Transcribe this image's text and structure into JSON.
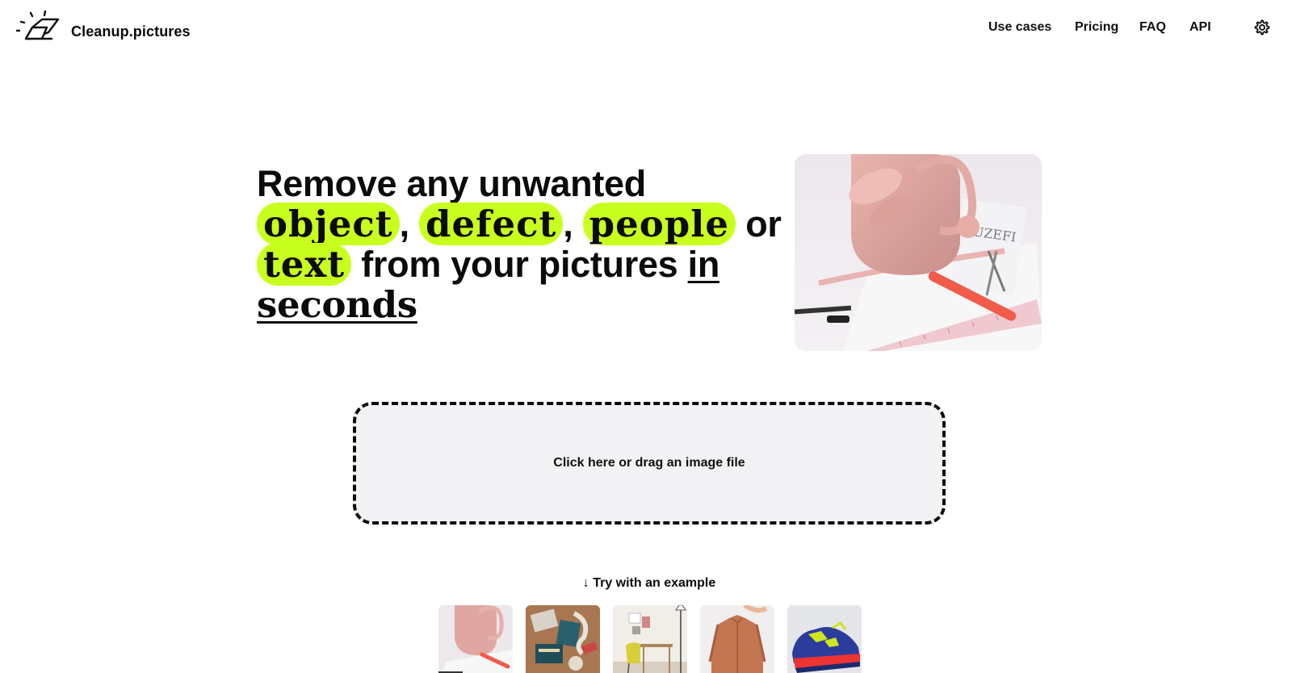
{
  "brand": {
    "name": "Cleanup.pictures",
    "logo_icon": "eraser-icon"
  },
  "nav": {
    "items": [
      {
        "label": "Use cases"
      },
      {
        "label": "Pricing"
      },
      {
        "label": "FAQ"
      },
      {
        "label": "API"
      }
    ],
    "settings_icon": "gear-icon"
  },
  "hero": {
    "line1": "Remove any unwanted",
    "tag1": "object",
    "sep1": ",",
    "tag2": "defect",
    "sep2": ",",
    "tag3": "people",
    "or": "or",
    "tag4": "text",
    "from": "from your pictures",
    "in": "in",
    "seconds": "seconds",
    "accent_color": "#c9ff1e"
  },
  "upload": {
    "label": "Click here or drag an image file"
  },
  "examples": {
    "label": "Try with an example",
    "arrow_icon": "arrow-down-icon",
    "thumbnails": [
      "bag-example",
      "desk-items-example",
      "room-example",
      "jacket-example",
      "sneaker-example"
    ]
  }
}
